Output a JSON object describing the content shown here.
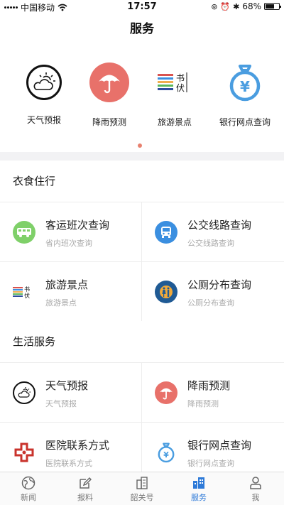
{
  "status_bar": {
    "carrier": "中国移动",
    "time": "17:57",
    "battery": "68%",
    "battery_level": 0.68
  },
  "header": {
    "title": "服务"
  },
  "carousel": {
    "items": [
      {
        "label": "天气预报",
        "icon": "weather-icon"
      },
      {
        "label": "降雨预测",
        "icon": "umbrella-icon"
      },
      {
        "label": "旅游景点",
        "icon": "tourism-icon"
      },
      {
        "label": "银行网点查询",
        "icon": "bank-money-bag-icon"
      }
    ],
    "page_indicator": {
      "pages": 1,
      "current": 1
    }
  },
  "sections": [
    {
      "title": "衣食住行",
      "items": [
        {
          "title": "客运班次查询",
          "subtitle": "省内班次查询",
          "icon": "coach-bus-icon"
        },
        {
          "title": "公交线路查询",
          "subtitle": "公交线路查询",
          "icon": "city-bus-icon"
        },
        {
          "title": "旅游景点",
          "subtitle": "旅游景点",
          "icon": "tourism-icon"
        },
        {
          "title": "公厕分布查询",
          "subtitle": "公厕分布查询",
          "icon": "restroom-icon"
        }
      ]
    },
    {
      "title": "生活服务",
      "items": [
        {
          "title": "天气预报",
          "subtitle": "天气预报",
          "icon": "weather-icon"
        },
        {
          "title": "降雨预测",
          "subtitle": "降雨预测",
          "icon": "umbrella-icon"
        },
        {
          "title": "医院联系方式",
          "subtitle": "医院联系方式",
          "icon": "hospital-cross-icon"
        },
        {
          "title": "银行网点查询",
          "subtitle": "银行网点查询",
          "icon": "bank-money-bag-icon"
        }
      ]
    }
  ],
  "tabbar": {
    "tabs": [
      {
        "label": "新闻",
        "icon": "globe-icon",
        "active": false
      },
      {
        "label": "报料",
        "icon": "edit-icon",
        "active": false
      },
      {
        "label": "韶关号",
        "icon": "building-icon",
        "active": false
      },
      {
        "label": "服务",
        "icon": "city-icon",
        "active": true
      },
      {
        "label": "我",
        "icon": "person-icon",
        "active": false
      }
    ]
  },
  "colors": {
    "umbrella": "#e8716a",
    "bus_green": "#7fd069",
    "bus_blue": "#3b8fe0",
    "restroom_dark": "#1f5a94",
    "bank_blue": "#4a9de0",
    "hospital_red": "#c9332c",
    "tab_active": "#2e7ad8",
    "page_dot": "#e8816f"
  }
}
